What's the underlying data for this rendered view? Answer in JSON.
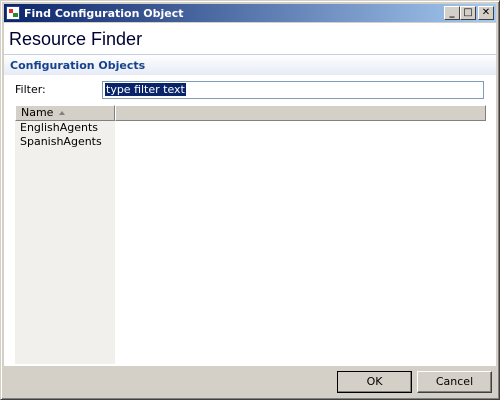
{
  "window": {
    "title": "Find Configuration Object",
    "controls": {
      "minimize": "_",
      "maximize": "□",
      "close": "✕"
    }
  },
  "header": {
    "title": "Resource Finder"
  },
  "section": {
    "title": "Configuration Objects"
  },
  "filter": {
    "label": "Filter:",
    "value": "type filter text"
  },
  "table": {
    "columns": [
      "Name"
    ],
    "rows": [
      "EnglishAgents",
      "SpanishAgents"
    ]
  },
  "footer": {
    "ok_label": "OK",
    "cancel_label": "Cancel"
  },
  "colors": {
    "title_bar": "#0a246a",
    "section_title": "#15428b",
    "selection": "#0a246a"
  }
}
